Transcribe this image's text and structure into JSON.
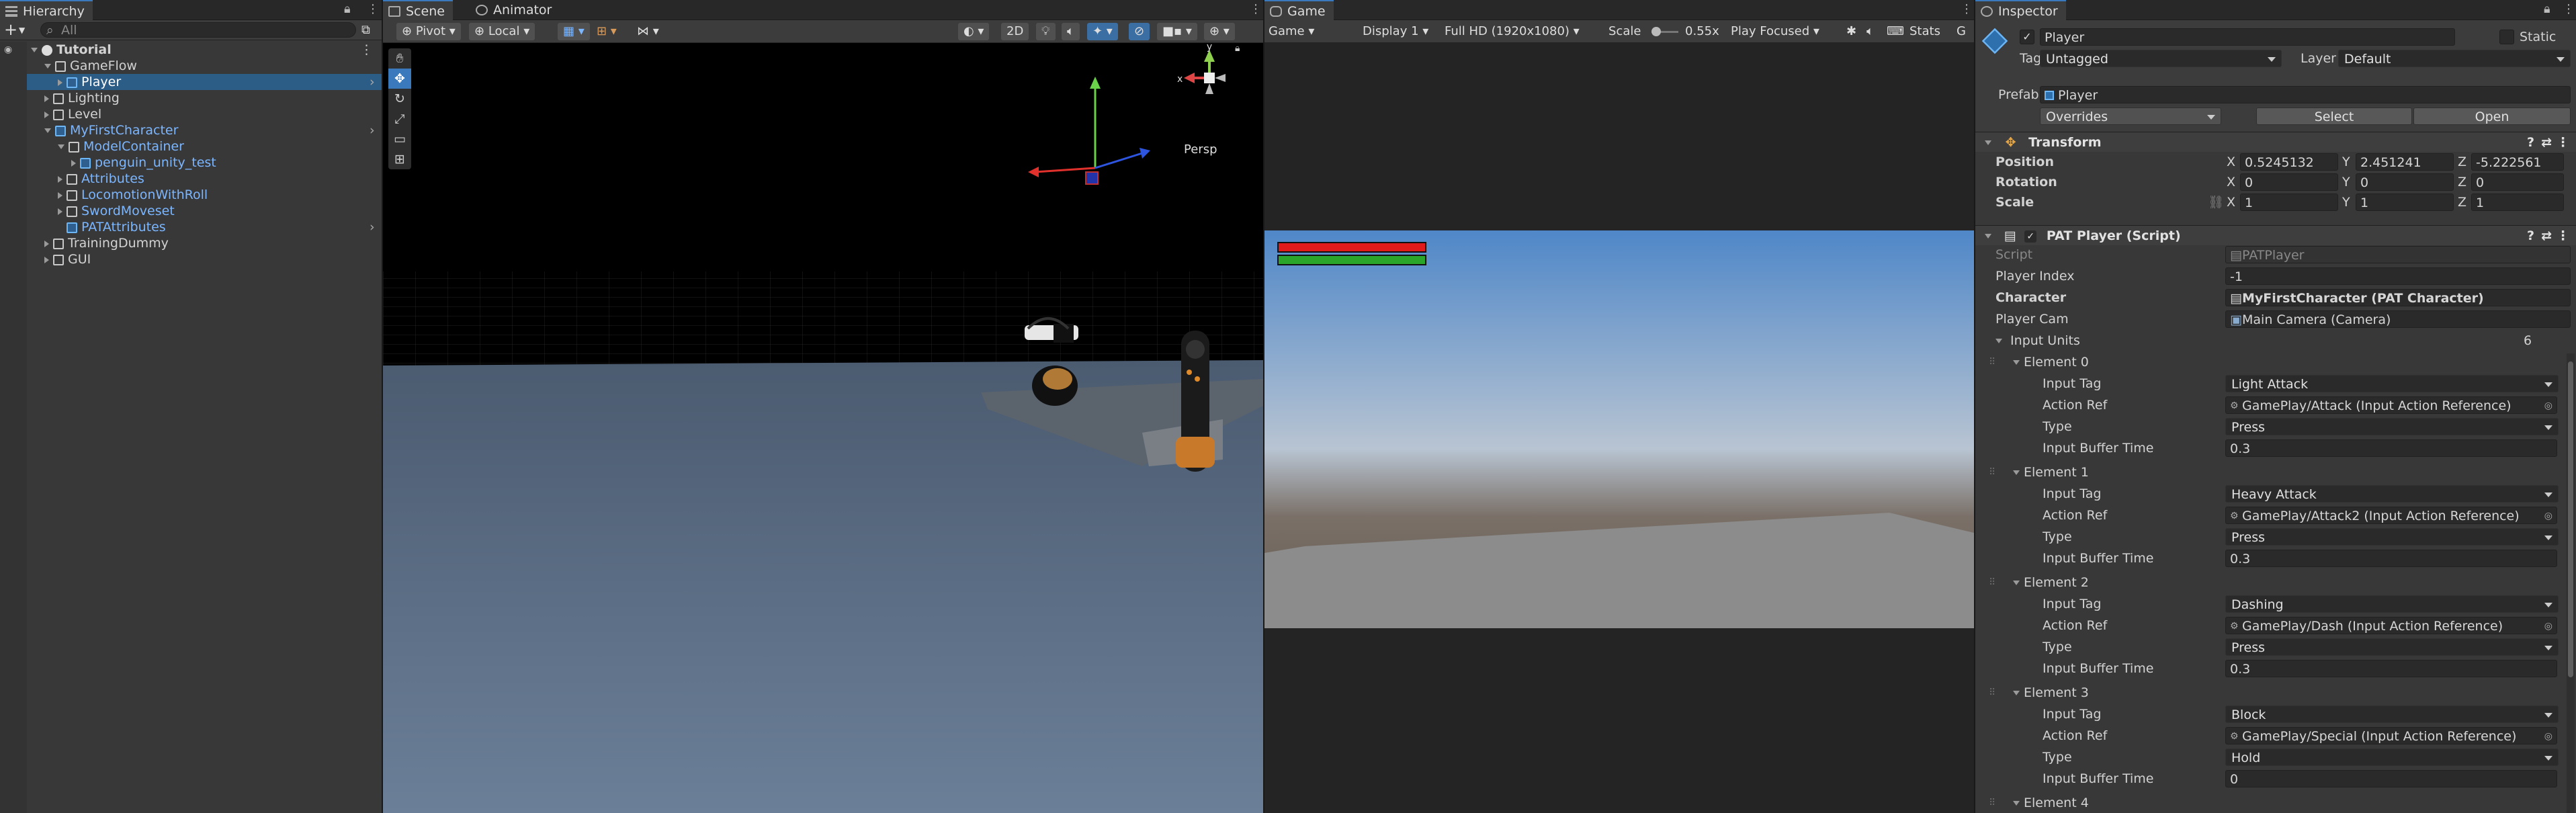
{
  "colors": {
    "accent": "#3a79bb",
    "selection": "#2c5d87",
    "health_red": "#e11a1a",
    "stamina_green": "#2aa52a"
  },
  "hierarchy": {
    "tab": "Hierarchy",
    "search_placeholder": "All",
    "add_label": "+",
    "items": [
      {
        "label": "Tutorial",
        "depth": 0,
        "fold": "open",
        "icon": "unity-scene-icon",
        "bold": true
      },
      {
        "label": "GameFlow",
        "depth": 1,
        "fold": "open",
        "icon": "gameobject-icon"
      },
      {
        "label": "Player",
        "depth": 2,
        "fold": "closed",
        "icon": "prefab-icon",
        "blue": true,
        "selected": true
      },
      {
        "label": "Lighting",
        "depth": 1,
        "fold": "closed",
        "icon": "gameobject-icon"
      },
      {
        "label": "Level",
        "depth": 1,
        "fold": "closed",
        "icon": "gameobject-icon"
      },
      {
        "label": "MyFirstCharacter",
        "depth": 1,
        "fold": "open",
        "icon": "prefab-icon",
        "blue": true
      },
      {
        "label": "ModelContainer",
        "depth": 2,
        "fold": "open",
        "icon": "gameobject-icon",
        "blue": true
      },
      {
        "label": "penguin_unity_test",
        "depth": 3,
        "fold": "closed",
        "icon": "prefab-icon",
        "blue": true
      },
      {
        "label": "Attributes",
        "depth": 2,
        "fold": "closed",
        "icon": "gameobject-icon",
        "blue": true
      },
      {
        "label": "LocomotionWithRoll",
        "depth": 2,
        "fold": "closed",
        "icon": "gameobject-icon",
        "blue": true
      },
      {
        "label": "SwordMoveset",
        "depth": 2,
        "fold": "closed",
        "icon": "gameobject-icon",
        "blue": true
      },
      {
        "label": "PATAttributes",
        "depth": 2,
        "fold": "none",
        "icon": "prefab-icon",
        "blue": true
      },
      {
        "label": "TrainingDummy",
        "depth": 1,
        "fold": "closed",
        "icon": "gameobject-icon"
      },
      {
        "label": "GUI",
        "depth": 1,
        "fold": "closed",
        "icon": "gameobject-icon"
      }
    ]
  },
  "scene": {
    "tabs": [
      "Scene",
      "Animator"
    ],
    "pivot": "Pivot",
    "local": "Local",
    "mode2d": "2D",
    "persp": "Persp",
    "gizmo_labels": {
      "x": "x",
      "y": "y"
    }
  },
  "game": {
    "tab": "Game",
    "view": "Game",
    "display": "Display 1",
    "resolution": "Full HD (1920x1080)",
    "scale_label": "Scale",
    "scale_value": "0.55x",
    "play_mode": "Play Focused",
    "stats": "Stats",
    "gizmos": "G"
  },
  "inspector": {
    "tab": "Inspector",
    "object_name": "Player",
    "static_label": "Static",
    "tag_label": "Tag",
    "tag_value": "Untagged",
    "layer_label": "Layer",
    "layer_value": "Default",
    "prefab_label": "Prefab",
    "prefab_value": "Player",
    "overrides": "Overrides",
    "select": "Select",
    "open": "Open",
    "transform": {
      "title": "Transform",
      "rows": [
        {
          "label": "Position",
          "x": "0.5245132",
          "y": "2.451241",
          "z": "-5.222561"
        },
        {
          "label": "Rotation",
          "x": "0",
          "y": "0",
          "z": "0"
        },
        {
          "label": "Scale",
          "x": "1",
          "y": "1",
          "z": "1"
        }
      ],
      "axis": {
        "x": "X",
        "y": "Y",
        "z": "Z"
      }
    },
    "script_comp": {
      "title": "PAT Player (Script)",
      "script_label": "Script",
      "script_value": "PATPlayer",
      "player_index_label": "Player Index",
      "player_index_value": "-1",
      "character_label": "Character",
      "character_value": "MyFirstCharacter (PAT Character)",
      "player_cam_label": "Player Cam",
      "player_cam_value": "Main Camera (Camera)",
      "input_units_label": "Input Units",
      "input_units_count": "6",
      "field_labels": {
        "tag": "Input Tag",
        "ref": "Action Ref",
        "type": "Type",
        "buffer": "Input Buffer Time"
      },
      "elements": [
        {
          "name": "Element 0",
          "tag": "Light Attack",
          "ref": "GamePlay/Attack (Input Action Reference)",
          "type": "Press",
          "buffer": "0.3"
        },
        {
          "name": "Element 1",
          "tag": "Heavy Attack",
          "ref": "GamePlay/Attack2 (Input Action Reference)",
          "type": "Press",
          "buffer": "0.3"
        },
        {
          "name": "Element 2",
          "tag": "Dashing",
          "ref": "GamePlay/Dash (Input Action Reference)",
          "type": "Press",
          "buffer": "0.3"
        },
        {
          "name": "Element 3",
          "tag": "Block",
          "ref": "GamePlay/Special (Input Action Reference)",
          "type": "Hold",
          "buffer": "0"
        },
        {
          "name": "Element 4"
        }
      ]
    }
  }
}
